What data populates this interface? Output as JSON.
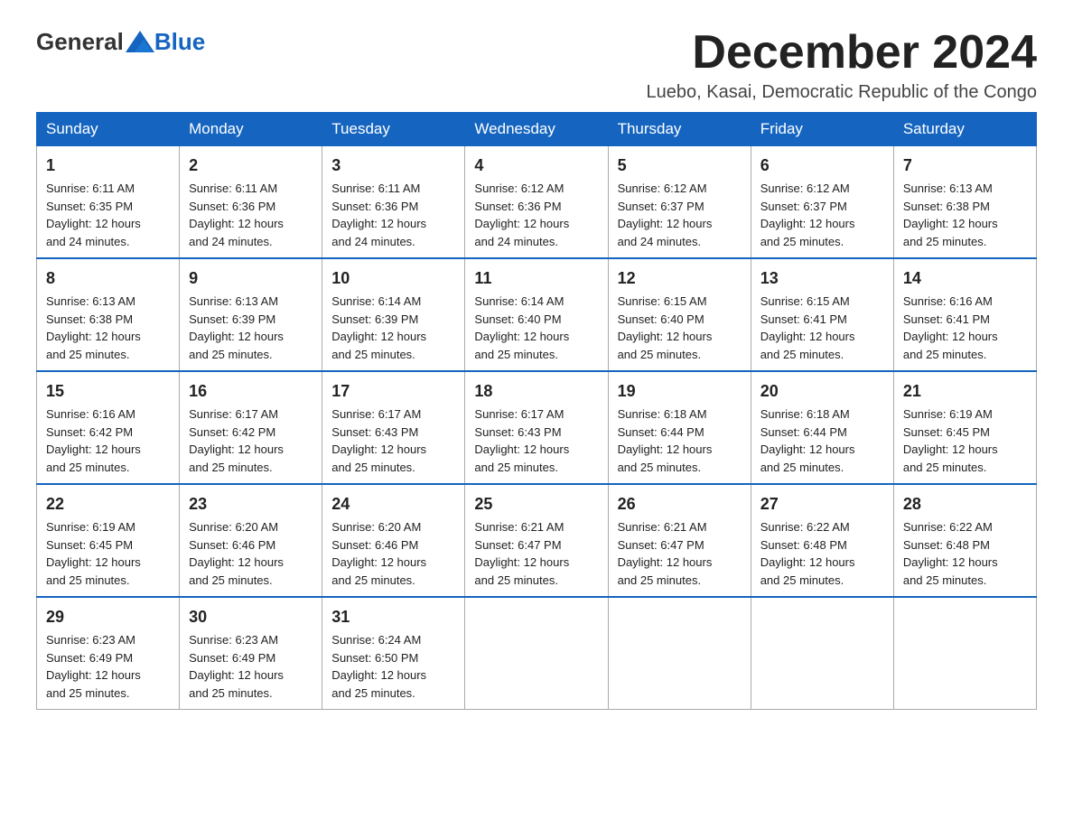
{
  "header": {
    "logo_general": "General",
    "logo_blue": "Blue",
    "month_title": "December 2024",
    "location": "Luebo, Kasai, Democratic Republic of the Congo"
  },
  "weekdays": [
    "Sunday",
    "Monday",
    "Tuesday",
    "Wednesday",
    "Thursday",
    "Friday",
    "Saturday"
  ],
  "weeks": [
    [
      {
        "day": "1",
        "sunrise": "6:11 AM",
        "sunset": "6:35 PM",
        "daylight": "12 hours and 24 minutes."
      },
      {
        "day": "2",
        "sunrise": "6:11 AM",
        "sunset": "6:36 PM",
        "daylight": "12 hours and 24 minutes."
      },
      {
        "day": "3",
        "sunrise": "6:11 AM",
        "sunset": "6:36 PM",
        "daylight": "12 hours and 24 minutes."
      },
      {
        "day": "4",
        "sunrise": "6:12 AM",
        "sunset": "6:36 PM",
        "daylight": "12 hours and 24 minutes."
      },
      {
        "day": "5",
        "sunrise": "6:12 AM",
        "sunset": "6:37 PM",
        "daylight": "12 hours and 24 minutes."
      },
      {
        "day": "6",
        "sunrise": "6:12 AM",
        "sunset": "6:37 PM",
        "daylight": "12 hours and 25 minutes."
      },
      {
        "day": "7",
        "sunrise": "6:13 AM",
        "sunset": "6:38 PM",
        "daylight": "12 hours and 25 minutes."
      }
    ],
    [
      {
        "day": "8",
        "sunrise": "6:13 AM",
        "sunset": "6:38 PM",
        "daylight": "12 hours and 25 minutes."
      },
      {
        "day": "9",
        "sunrise": "6:13 AM",
        "sunset": "6:39 PM",
        "daylight": "12 hours and 25 minutes."
      },
      {
        "day": "10",
        "sunrise": "6:14 AM",
        "sunset": "6:39 PM",
        "daylight": "12 hours and 25 minutes."
      },
      {
        "day": "11",
        "sunrise": "6:14 AM",
        "sunset": "6:40 PM",
        "daylight": "12 hours and 25 minutes."
      },
      {
        "day": "12",
        "sunrise": "6:15 AM",
        "sunset": "6:40 PM",
        "daylight": "12 hours and 25 minutes."
      },
      {
        "day": "13",
        "sunrise": "6:15 AM",
        "sunset": "6:41 PM",
        "daylight": "12 hours and 25 minutes."
      },
      {
        "day": "14",
        "sunrise": "6:16 AM",
        "sunset": "6:41 PM",
        "daylight": "12 hours and 25 minutes."
      }
    ],
    [
      {
        "day": "15",
        "sunrise": "6:16 AM",
        "sunset": "6:42 PM",
        "daylight": "12 hours and 25 minutes."
      },
      {
        "day": "16",
        "sunrise": "6:17 AM",
        "sunset": "6:42 PM",
        "daylight": "12 hours and 25 minutes."
      },
      {
        "day": "17",
        "sunrise": "6:17 AM",
        "sunset": "6:43 PM",
        "daylight": "12 hours and 25 minutes."
      },
      {
        "day": "18",
        "sunrise": "6:17 AM",
        "sunset": "6:43 PM",
        "daylight": "12 hours and 25 minutes."
      },
      {
        "day": "19",
        "sunrise": "6:18 AM",
        "sunset": "6:44 PM",
        "daylight": "12 hours and 25 minutes."
      },
      {
        "day": "20",
        "sunrise": "6:18 AM",
        "sunset": "6:44 PM",
        "daylight": "12 hours and 25 minutes."
      },
      {
        "day": "21",
        "sunrise": "6:19 AM",
        "sunset": "6:45 PM",
        "daylight": "12 hours and 25 minutes."
      }
    ],
    [
      {
        "day": "22",
        "sunrise": "6:19 AM",
        "sunset": "6:45 PM",
        "daylight": "12 hours and 25 minutes."
      },
      {
        "day": "23",
        "sunrise": "6:20 AM",
        "sunset": "6:46 PM",
        "daylight": "12 hours and 25 minutes."
      },
      {
        "day": "24",
        "sunrise": "6:20 AM",
        "sunset": "6:46 PM",
        "daylight": "12 hours and 25 minutes."
      },
      {
        "day": "25",
        "sunrise": "6:21 AM",
        "sunset": "6:47 PM",
        "daylight": "12 hours and 25 minutes."
      },
      {
        "day": "26",
        "sunrise": "6:21 AM",
        "sunset": "6:47 PM",
        "daylight": "12 hours and 25 minutes."
      },
      {
        "day": "27",
        "sunrise": "6:22 AM",
        "sunset": "6:48 PM",
        "daylight": "12 hours and 25 minutes."
      },
      {
        "day": "28",
        "sunrise": "6:22 AM",
        "sunset": "6:48 PM",
        "daylight": "12 hours and 25 minutes."
      }
    ],
    [
      {
        "day": "29",
        "sunrise": "6:23 AM",
        "sunset": "6:49 PM",
        "daylight": "12 hours and 25 minutes."
      },
      {
        "day": "30",
        "sunrise": "6:23 AM",
        "sunset": "6:49 PM",
        "daylight": "12 hours and 25 minutes."
      },
      {
        "day": "31",
        "sunrise": "6:24 AM",
        "sunset": "6:50 PM",
        "daylight": "12 hours and 25 minutes."
      },
      null,
      null,
      null,
      null
    ]
  ],
  "labels": {
    "sunrise_prefix": "Sunrise: ",
    "sunset_prefix": "Sunset: ",
    "daylight_prefix": "Daylight: "
  }
}
